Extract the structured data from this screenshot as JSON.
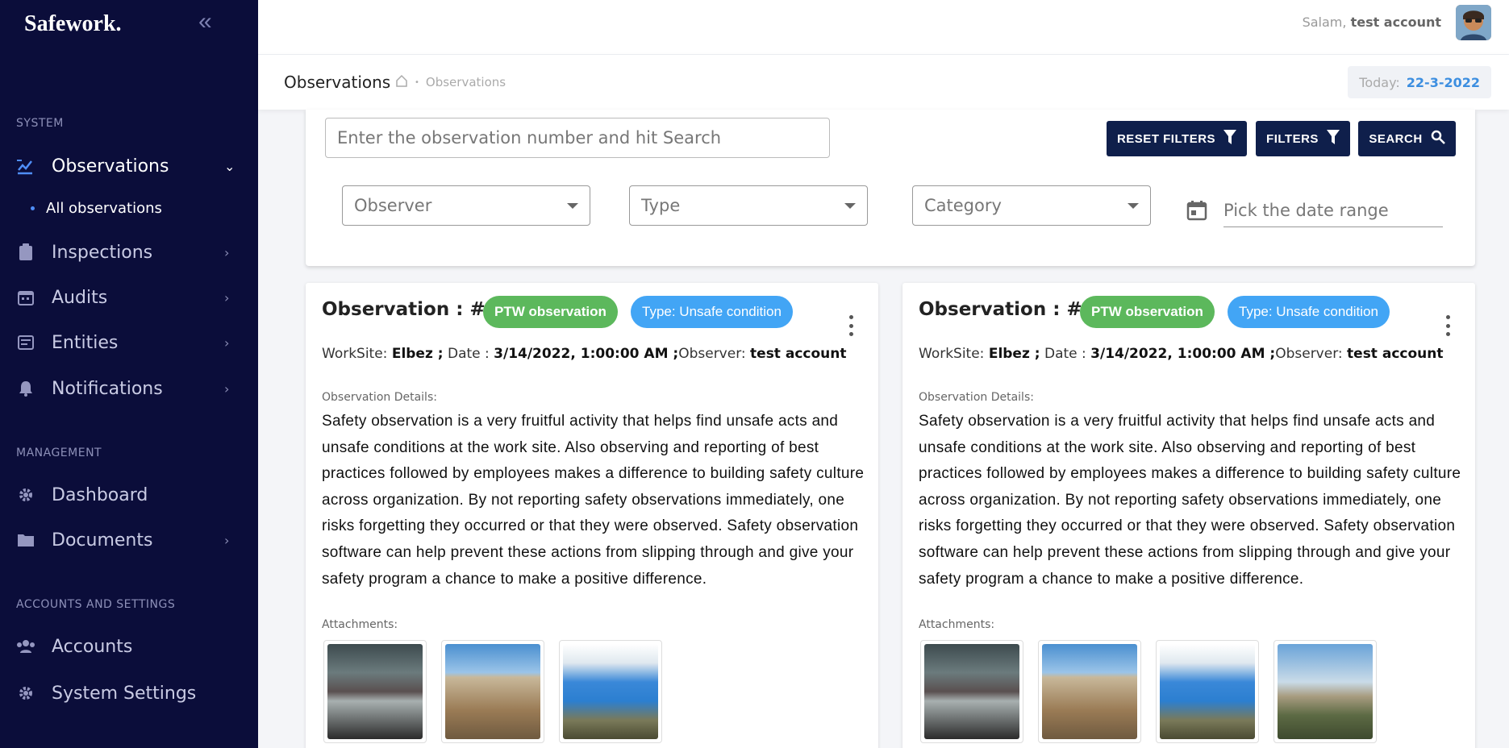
{
  "app": {
    "brand": "Safework."
  },
  "sidebar": {
    "sections": {
      "system": "SYSTEM",
      "management": "MANAGEMENT",
      "accounts": "ACCOUNTS AND SETTINGS"
    },
    "items": [
      {
        "label": "Observations",
        "icon": "observations-icon",
        "active": true
      },
      {
        "label": "Inspections",
        "icon": "clipboard-icon"
      },
      {
        "label": "Audits",
        "icon": "calendar-icon"
      },
      {
        "label": "Entities",
        "icon": "entities-icon"
      },
      {
        "label": "Notifications",
        "icon": "bell-icon"
      },
      {
        "label": "Dashboard",
        "icon": "gear-icon"
      },
      {
        "label": "Documents",
        "icon": "folder-icon"
      },
      {
        "label": "Accounts",
        "icon": "users-icon"
      },
      {
        "label": "System Settings",
        "icon": "gear-icon"
      }
    ],
    "sub_item": "All observations"
  },
  "topbar": {
    "greeting": "Salam,",
    "user": "test account"
  },
  "subheader": {
    "title": "Observations",
    "breadcrumb": "Observations",
    "today_label": "Today:",
    "today_value": "22-3-2022"
  },
  "filters": {
    "search_placeholder": "Enter the observation number and hit Search",
    "reset_label": "RESET FILTERS",
    "filters_label": "FILTERS",
    "search_label": "SEARCH",
    "observer_placeholder": "Observer",
    "type_placeholder": "Type",
    "category_placeholder": "Category",
    "date_placeholder": "Pick the date range"
  },
  "observations": [
    {
      "title": "Observation : #16",
      "badge": "PTW observation",
      "type": "Type: Unsafe condition",
      "worksite_label": "WorkSite:",
      "worksite": "Elbez ;",
      "date_label": "Date :",
      "date": "3/14/2022, 1:00:00 AM ;",
      "observer_label": "Observer:",
      "observer": "test account",
      "details_label": "Observation Details:",
      "details": "Safety observation is a very fruitful activity that helps find unsafe acts and unsafe conditions at the work site. Also observing and reporting of best practices followed by employees makes a difference to building safety culture across organization. By not reporting safety observations immediately, one risks forgetting they occurred or that they were observed. Safety observation software can help prevent these actions from slipping through and give your safety program a chance to make a positive difference.",
      "attachments_label": "Attachments:"
    },
    {
      "title": "Observation : #15",
      "badge": "PTW observation",
      "type": "Type: Unsafe condition",
      "worksite_label": "WorkSite:",
      "worksite": "Elbez ;",
      "date_label": "Date :",
      "date": "3/14/2022, 1:00:00 AM ;",
      "observer_label": "Observer:",
      "observer": "test account",
      "details_label": "Observation Details:",
      "details": "Safety observation is a very fruitful activity that helps find unsafe acts and unsafe conditions at the work site. Also observing and reporting of best practices followed by employees makes a difference to building safety culture across organization. By not reporting safety observations immediately, one risks forgetting they occurred or that they were observed. Safety observation software can help prevent these actions from slipping through and give your safety program a chance to make a positive difference.",
      "attachments_label": "Attachments:"
    }
  ],
  "colors": {
    "sidebar_bg": "#0b0d3a",
    "accent_blue": "#4f8ef7",
    "button_dark": "#0f1f4b",
    "pill_green": "#5cb85c",
    "pill_blue": "#42a5f5"
  }
}
